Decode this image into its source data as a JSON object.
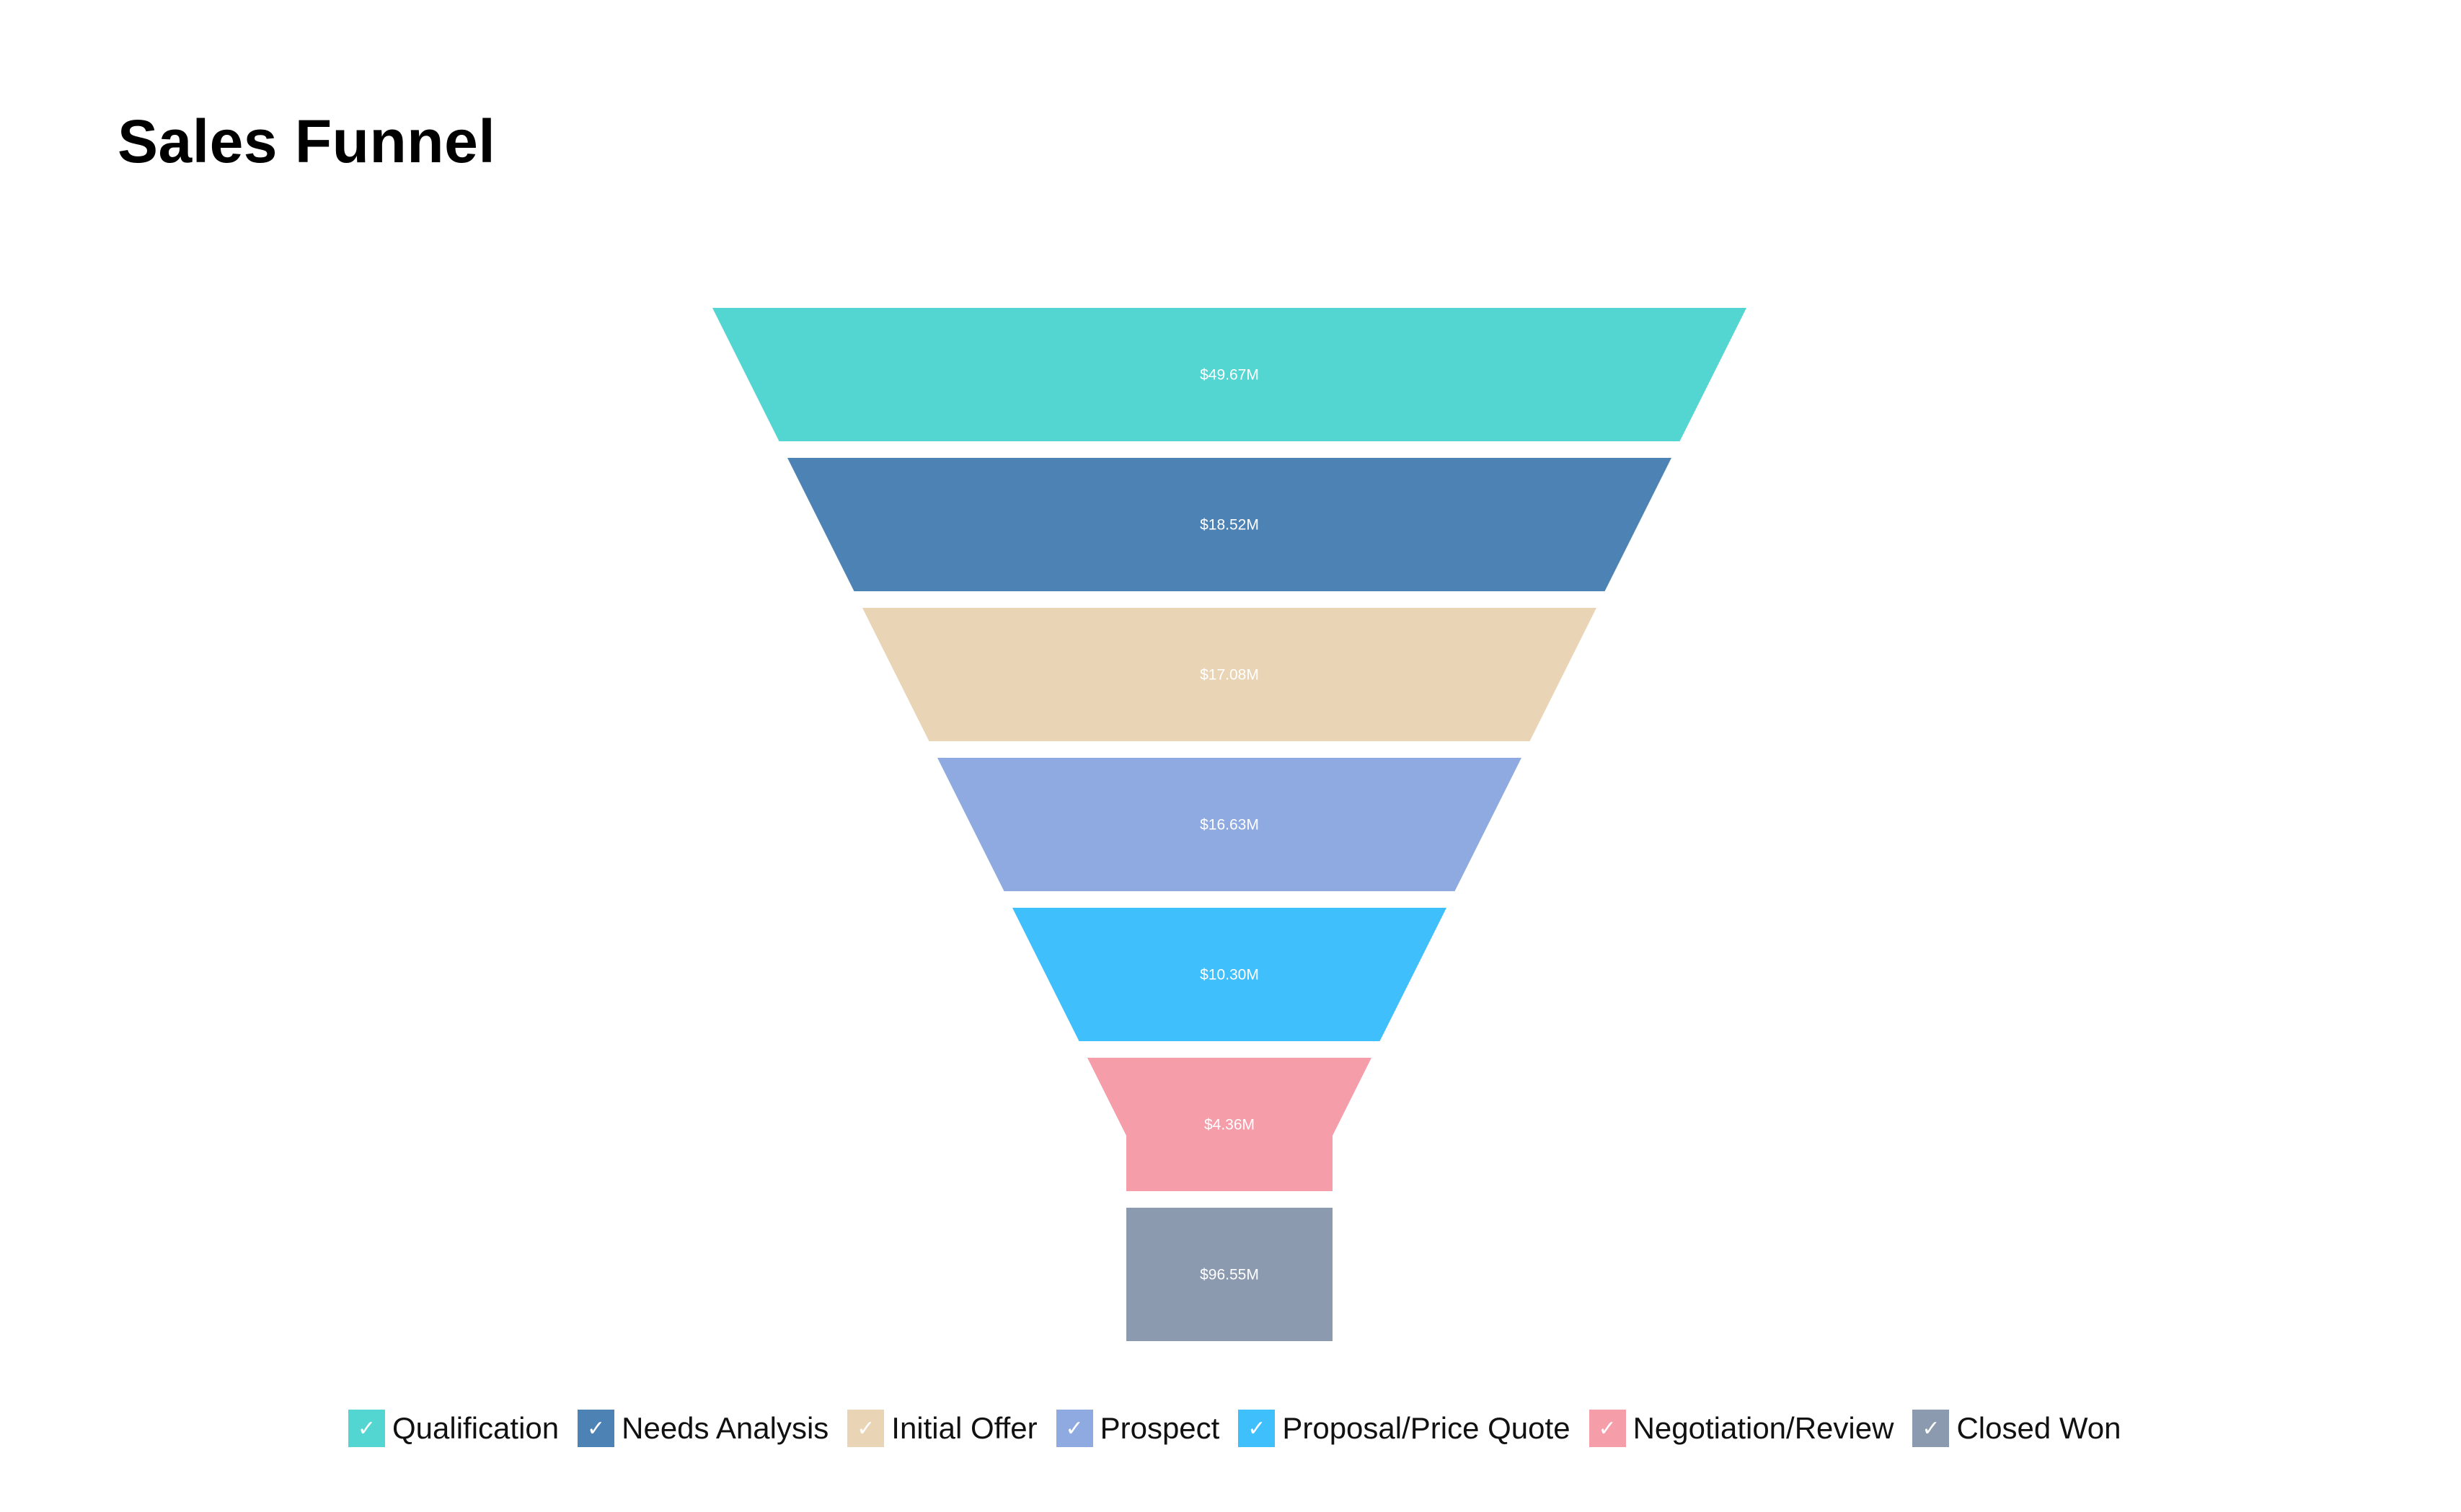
{
  "title": "Sales Funnel",
  "chart_data": {
    "type": "funnel",
    "title": "Sales Funnel",
    "stages": [
      {
        "name": "Qualification",
        "value": 49.67,
        "label": "$49.67M",
        "color": "#53D5D2"
      },
      {
        "name": "Needs Analysis",
        "value": 18.52,
        "label": "$18.52M",
        "color": "#4D83B4"
      },
      {
        "name": "Initial Offer",
        "value": 17.08,
        "label": "$17.08M",
        "color": "#E9D5B5"
      },
      {
        "name": "Prospect",
        "value": 16.63,
        "label": "$16.63M",
        "color": "#8FAAE1"
      },
      {
        "name": "Proposal/Price Quote",
        "value": 10.3,
        "label": "$10.30M",
        "color": "#40BFFD"
      },
      {
        "name": "Negotiation/Review",
        "value": 4.36,
        "label": "$4.36M",
        "color": "#F69DAA"
      },
      {
        "name": "Closed Won",
        "value": 96.55,
        "label": "$96.55M",
        "color": "#8C9AB0"
      }
    ],
    "unit": "USD millions",
    "legend_position": "bottom",
    "legend": [
      {
        "label": "Qualification",
        "checked": true
      },
      {
        "label": "Needs Analysis",
        "checked": true
      },
      {
        "label": "Initial Offer",
        "checked": true
      },
      {
        "label": "Prospect",
        "checked": true
      },
      {
        "label": "Proposal/Price Quote",
        "checked": true
      },
      {
        "label": "Negotiation/Review",
        "checked": true
      },
      {
        "label": "Closed Won",
        "checked": true
      }
    ]
  },
  "icons": {
    "legend_check": "✓"
  }
}
